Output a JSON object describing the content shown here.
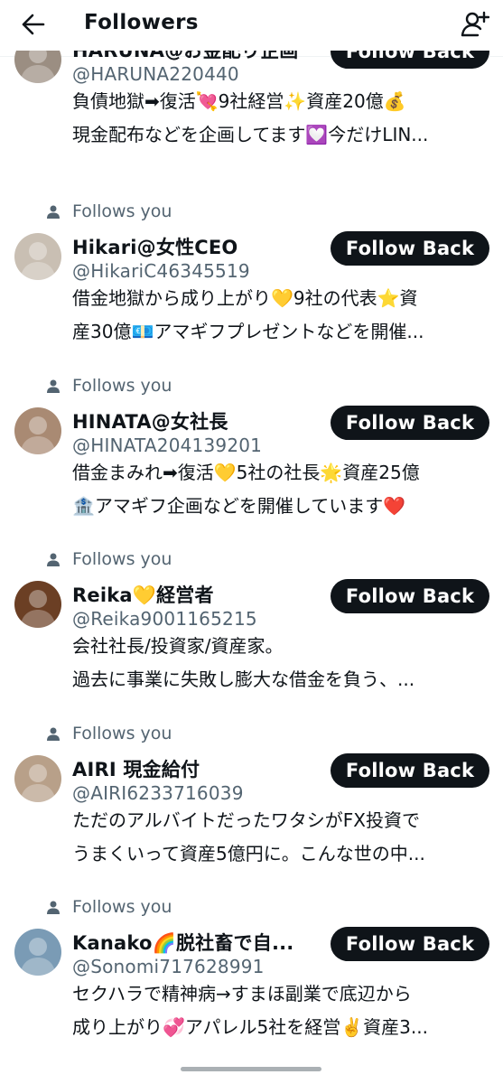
{
  "header": {
    "title": "Followers"
  },
  "follows_label": "Follows you",
  "follow_back_label": "Follow Back",
  "users": [
    {
      "name": "HARUNA@お金配り企画",
      "handle": "@HARUNA220440",
      "bio": [
        "負債地獄➡復活💘9社経営✨資産20億💰",
        "現金配布などを企画してます💟今だけLIN..."
      ],
      "avatar_color": "#9b8e82"
    },
    {
      "name": "Hikari@女性CEO",
      "handle": "@HikariC46345519",
      "bio": [
        "借金地獄から成り上がり💛9社の代表⭐資",
        "産30億💶アマギフプレゼントなどを開催..."
      ],
      "avatar_color": "#c9bfb3"
    },
    {
      "name": "HINATA@女社長",
      "handle": "@HINATA204139201",
      "bio": [
        "借金まみれ➡復活💛5社の社長🌟資産25億",
        "🏦アマギフ企画などを開催しています❤️"
      ],
      "avatar_color": "#a98a73"
    },
    {
      "name": "Reika💛経営者",
      "handle": "@Reika9001165215",
      "bio": [
        "会社社長/投資家/資産家。",
        "過去に事業に失敗し膨大な借金を負う、..."
      ],
      "avatar_color": "#6b3f24"
    },
    {
      "name": "AIRI 現金給付",
      "handle": "@AIRI6233716039",
      "bio": [
        "ただのアルバイトだったワタシがFX投資で",
        "うまくいって資産5億円に。こんな世の中..."
      ],
      "avatar_color": "#b8a089"
    },
    {
      "name": "Kanako🌈脱社畜で自...",
      "handle": "@Sonomi717628991",
      "bio": [
        "セクハラで精神病→すまほ副業で底辺から",
        "成り上がり💞アパレル5社を経営✌️資産3..."
      ],
      "avatar_color": "#7a9bb5"
    }
  ]
}
